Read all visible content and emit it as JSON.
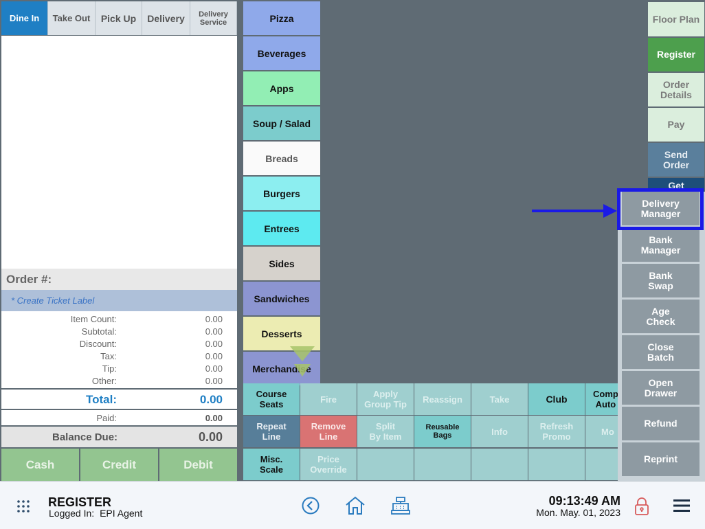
{
  "order_tabs": [
    "Dine In",
    "Take Out",
    "Pick Up",
    "Delivery",
    "Delivery\nService"
  ],
  "ticket": {
    "order_label": "Order #:",
    "create_ticket_label": "* Create Ticket Label",
    "rows": [
      {
        "label": "Item Count:",
        "value": "0.00"
      },
      {
        "label": "Subtotal:",
        "value": "0.00"
      },
      {
        "label": "Discount:",
        "value": "0.00"
      },
      {
        "label": "Tax:",
        "value": "0.00"
      },
      {
        "label": "Tip:",
        "value": "0.00"
      },
      {
        "label": "Other:",
        "value": "0.00"
      }
    ],
    "total_label": "Total:",
    "total_value": "0.00",
    "paid_label": "Paid:",
    "paid_value": "0.00",
    "balance_label": "Balance Due:",
    "balance_value": "0.00"
  },
  "payment_buttons": [
    "Cash",
    "Credit",
    "Debit"
  ],
  "categories": [
    "Pizza",
    "Beverages",
    "Apps",
    "Soup / Salad",
    "Breads",
    "Burgers",
    "Entrees",
    "Sides",
    "Sandwiches",
    "Desserts",
    "Merchandise"
  ],
  "action_grid": {
    "row1": [
      "Course\nSeats",
      "Fire",
      "Apply\nGroup Tip",
      "Reassign",
      "Take",
      "Club",
      "Comp\nAuto"
    ],
    "row2": [
      "Repeat\nLine",
      "Remove\nLine",
      "Split\nBy Item",
      "Reusable\nBags",
      "Info",
      "Refresh\nPromo",
      "Mo"
    ],
    "row3": [
      "Misc.\nScale",
      "Price\nOverride"
    ]
  },
  "side_buttons": [
    "Floor Plan",
    "Register",
    "Order\nDetails",
    "Pay",
    "Send\nOrder",
    "Get"
  ],
  "more_menu": [
    "Delivery\nManager",
    "Bank\nManager",
    "Bank\nSwap",
    "Age\nCheck",
    "Close\nBatch",
    "Open\nDrawer",
    "Refund",
    "Reprint"
  ],
  "footer": {
    "title": "REGISTER",
    "logged_in_label": "Logged In:",
    "user": "EPI Agent",
    "time": "09:13:49 AM",
    "date": "Mon. May. 01, 2023"
  }
}
